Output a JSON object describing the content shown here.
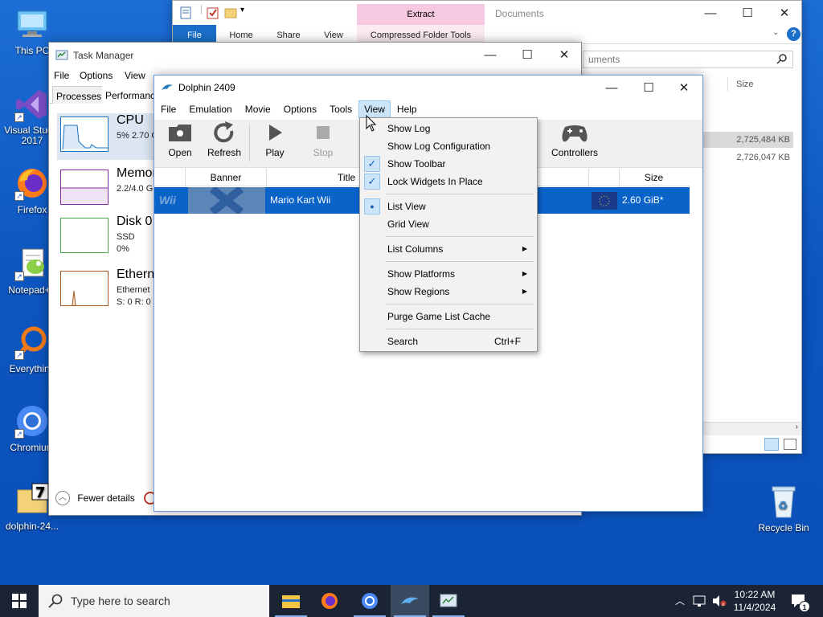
{
  "desktop": {
    "icons": [
      {
        "label": "This PC"
      },
      {
        "label": "Visual Studio 2017"
      },
      {
        "label": "Firefox"
      },
      {
        "label": "Notepad++"
      },
      {
        "label": "Everything"
      },
      {
        "label": "Chromium"
      },
      {
        "label": "dolphin-24..."
      },
      {
        "label": "Recycle Bin"
      }
    ]
  },
  "explorer": {
    "context_tab": "Extract",
    "title": "Documents",
    "tabs": [
      "File",
      "Home",
      "Share",
      "View",
      "Compressed Folder Tools"
    ],
    "search_placeholder": "uments",
    "size_header": "Size",
    "sizes": [
      "2,725,484 KB",
      "2,726,047 KB"
    ]
  },
  "taskmgr": {
    "title": "Task Manager",
    "menu": [
      "File",
      "Options",
      "View"
    ],
    "tabs": [
      "Processes",
      "Performance"
    ],
    "items": [
      {
        "name": "CPU",
        "sub1": "5%  2.70 G",
        "sub2": ""
      },
      {
        "name": "Memory",
        "sub1": "2.2/4.0 G",
        "sub2": ""
      },
      {
        "name": "Disk 0",
        "sub1": "SSD",
        "sub2": "0%"
      },
      {
        "name": "Ethernet",
        "sub1": "Ethernet",
        "sub2": "S: 0 R: 0"
      }
    ],
    "fewer_details": "Fewer details"
  },
  "dolphin": {
    "title": "Dolphin 2409",
    "menu": [
      "File",
      "Emulation",
      "Movie",
      "Options",
      "Tools",
      "View",
      "Help"
    ],
    "toolbar": [
      "Open",
      "Refresh",
      "Play",
      "Stop",
      "Controllers"
    ],
    "columns": {
      "banner": "Banner",
      "title": "Title",
      "size": "Size"
    },
    "game": {
      "platform": "Wii",
      "title": "Mario Kart Wii",
      "size": "2.60 GiB*"
    }
  },
  "view_menu": {
    "items": [
      {
        "label": "Show Log",
        "checked": false
      },
      {
        "label": "Show Log Configuration",
        "checked": false
      },
      {
        "label": "Show Toolbar",
        "checked": true
      },
      {
        "label": "Lock Widgets In Place",
        "checked": true
      },
      {
        "label": "List View",
        "radio": true
      },
      {
        "label": "Grid View"
      },
      {
        "label": "List Columns",
        "submenu": true
      },
      {
        "label": "Show Platforms",
        "submenu": true
      },
      {
        "label": "Show Regions",
        "submenu": true
      },
      {
        "label": "Purge Game List Cache"
      },
      {
        "label": "Search",
        "shortcut": "Ctrl+F"
      }
    ]
  },
  "taskbar": {
    "search_placeholder": "Type here to search",
    "time": "10:22 AM",
    "date": "11/4/2024",
    "notification_count": "1"
  },
  "colors": {
    "desktop": "#0c55c0",
    "selection": "#0a63c9",
    "menu_highlight": "#cce4f7",
    "extract_tab": "#f7c9e0",
    "taskbar": "#1a2434"
  }
}
